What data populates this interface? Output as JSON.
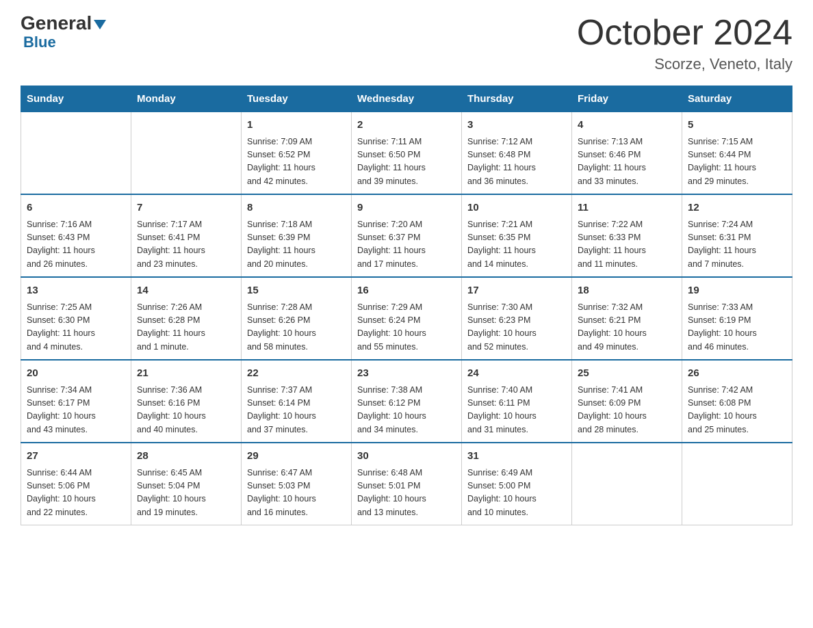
{
  "logo": {
    "general": "General",
    "triangle": "",
    "blue": "Blue"
  },
  "title": "October 2024",
  "subtitle": "Scorze, Veneto, Italy",
  "days_of_week": [
    "Sunday",
    "Monday",
    "Tuesday",
    "Wednesday",
    "Thursday",
    "Friday",
    "Saturday"
  ],
  "weeks": [
    [
      {
        "day": "",
        "info": ""
      },
      {
        "day": "",
        "info": ""
      },
      {
        "day": "1",
        "info": "Sunrise: 7:09 AM\nSunset: 6:52 PM\nDaylight: 11 hours\nand 42 minutes."
      },
      {
        "day": "2",
        "info": "Sunrise: 7:11 AM\nSunset: 6:50 PM\nDaylight: 11 hours\nand 39 minutes."
      },
      {
        "day": "3",
        "info": "Sunrise: 7:12 AM\nSunset: 6:48 PM\nDaylight: 11 hours\nand 36 minutes."
      },
      {
        "day": "4",
        "info": "Sunrise: 7:13 AM\nSunset: 6:46 PM\nDaylight: 11 hours\nand 33 minutes."
      },
      {
        "day": "5",
        "info": "Sunrise: 7:15 AM\nSunset: 6:44 PM\nDaylight: 11 hours\nand 29 minutes."
      }
    ],
    [
      {
        "day": "6",
        "info": "Sunrise: 7:16 AM\nSunset: 6:43 PM\nDaylight: 11 hours\nand 26 minutes."
      },
      {
        "day": "7",
        "info": "Sunrise: 7:17 AM\nSunset: 6:41 PM\nDaylight: 11 hours\nand 23 minutes."
      },
      {
        "day": "8",
        "info": "Sunrise: 7:18 AM\nSunset: 6:39 PM\nDaylight: 11 hours\nand 20 minutes."
      },
      {
        "day": "9",
        "info": "Sunrise: 7:20 AM\nSunset: 6:37 PM\nDaylight: 11 hours\nand 17 minutes."
      },
      {
        "day": "10",
        "info": "Sunrise: 7:21 AM\nSunset: 6:35 PM\nDaylight: 11 hours\nand 14 minutes."
      },
      {
        "day": "11",
        "info": "Sunrise: 7:22 AM\nSunset: 6:33 PM\nDaylight: 11 hours\nand 11 minutes."
      },
      {
        "day": "12",
        "info": "Sunrise: 7:24 AM\nSunset: 6:31 PM\nDaylight: 11 hours\nand 7 minutes."
      }
    ],
    [
      {
        "day": "13",
        "info": "Sunrise: 7:25 AM\nSunset: 6:30 PM\nDaylight: 11 hours\nand 4 minutes."
      },
      {
        "day": "14",
        "info": "Sunrise: 7:26 AM\nSunset: 6:28 PM\nDaylight: 11 hours\nand 1 minute."
      },
      {
        "day": "15",
        "info": "Sunrise: 7:28 AM\nSunset: 6:26 PM\nDaylight: 10 hours\nand 58 minutes."
      },
      {
        "day": "16",
        "info": "Sunrise: 7:29 AM\nSunset: 6:24 PM\nDaylight: 10 hours\nand 55 minutes."
      },
      {
        "day": "17",
        "info": "Sunrise: 7:30 AM\nSunset: 6:23 PM\nDaylight: 10 hours\nand 52 minutes."
      },
      {
        "day": "18",
        "info": "Sunrise: 7:32 AM\nSunset: 6:21 PM\nDaylight: 10 hours\nand 49 minutes."
      },
      {
        "day": "19",
        "info": "Sunrise: 7:33 AM\nSunset: 6:19 PM\nDaylight: 10 hours\nand 46 minutes."
      }
    ],
    [
      {
        "day": "20",
        "info": "Sunrise: 7:34 AM\nSunset: 6:17 PM\nDaylight: 10 hours\nand 43 minutes."
      },
      {
        "day": "21",
        "info": "Sunrise: 7:36 AM\nSunset: 6:16 PM\nDaylight: 10 hours\nand 40 minutes."
      },
      {
        "day": "22",
        "info": "Sunrise: 7:37 AM\nSunset: 6:14 PM\nDaylight: 10 hours\nand 37 minutes."
      },
      {
        "day": "23",
        "info": "Sunrise: 7:38 AM\nSunset: 6:12 PM\nDaylight: 10 hours\nand 34 minutes."
      },
      {
        "day": "24",
        "info": "Sunrise: 7:40 AM\nSunset: 6:11 PM\nDaylight: 10 hours\nand 31 minutes."
      },
      {
        "day": "25",
        "info": "Sunrise: 7:41 AM\nSunset: 6:09 PM\nDaylight: 10 hours\nand 28 minutes."
      },
      {
        "day": "26",
        "info": "Sunrise: 7:42 AM\nSunset: 6:08 PM\nDaylight: 10 hours\nand 25 minutes."
      }
    ],
    [
      {
        "day": "27",
        "info": "Sunrise: 6:44 AM\nSunset: 5:06 PM\nDaylight: 10 hours\nand 22 minutes."
      },
      {
        "day": "28",
        "info": "Sunrise: 6:45 AM\nSunset: 5:04 PM\nDaylight: 10 hours\nand 19 minutes."
      },
      {
        "day": "29",
        "info": "Sunrise: 6:47 AM\nSunset: 5:03 PM\nDaylight: 10 hours\nand 16 minutes."
      },
      {
        "day": "30",
        "info": "Sunrise: 6:48 AM\nSunset: 5:01 PM\nDaylight: 10 hours\nand 13 minutes."
      },
      {
        "day": "31",
        "info": "Sunrise: 6:49 AM\nSunset: 5:00 PM\nDaylight: 10 hours\nand 10 minutes."
      },
      {
        "day": "",
        "info": ""
      },
      {
        "day": "",
        "info": ""
      }
    ]
  ]
}
